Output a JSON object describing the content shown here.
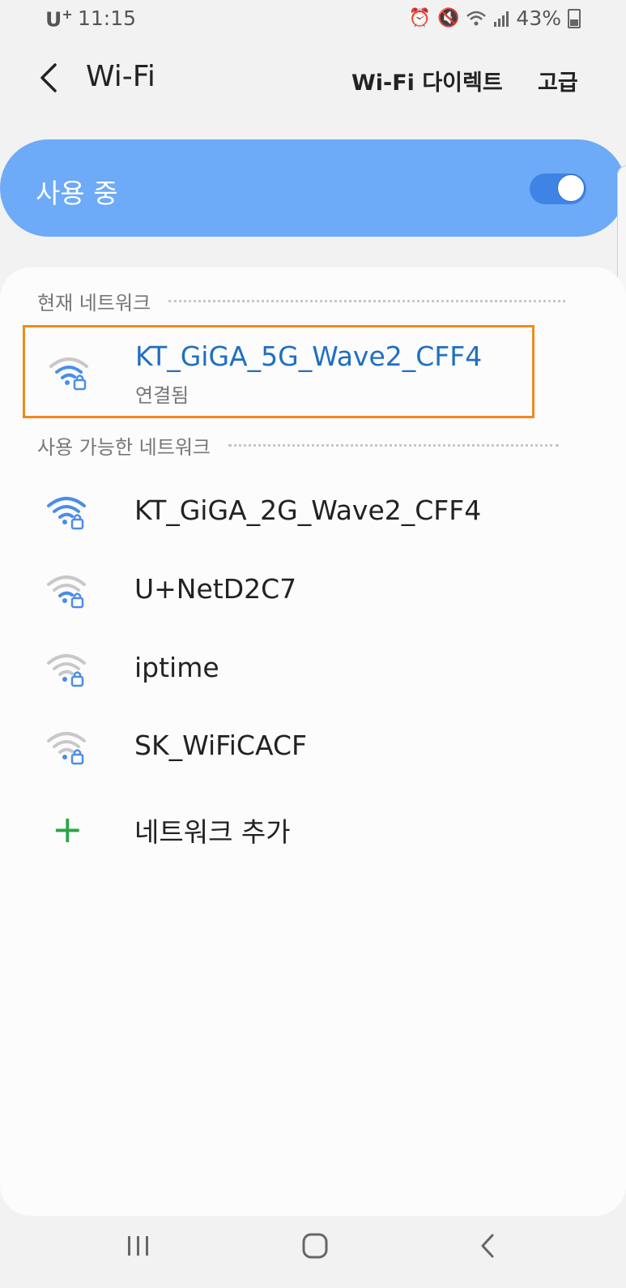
{
  "status_bar": {
    "carrier": "U",
    "carrier_sup": "+",
    "time": "11:15",
    "battery_percent": "43%",
    "icons": [
      "alarm-icon",
      "mute-icon",
      "wifi-status-icon",
      "signal-icon",
      "battery-icon"
    ]
  },
  "app_bar": {
    "title": "Wi-Fi",
    "wifi_direct_label": "Wi-Fi 다이렉트",
    "advanced_label": "고급"
  },
  "master_switch": {
    "label": "사용 중",
    "state": true,
    "accent_color": "#6daaf7"
  },
  "current_network": {
    "section_title": "현재 네트워크",
    "name": "KT_GiGA_5G_Wave2_CFF4",
    "status": "연결됨",
    "signal_level": 0.75,
    "highlight_color": "#f28a1b"
  },
  "available_networks": {
    "section_title": "사용 가능한 네트워크",
    "items": [
      {
        "name": "KT_GiGA_2G_Wave2_CFF4",
        "signal_level": 1.0,
        "secured": true
      },
      {
        "name": "U+NetD2C7",
        "signal_level": 0.5,
        "secured": true
      },
      {
        "name": "iptime",
        "signal_level": 0.25,
        "secured": true
      },
      {
        "name": "SK_WiFiCACF",
        "signal_level": 0.25,
        "secured": true
      }
    ],
    "add_network_label": "네트워크 추가"
  },
  "nav_bar": {
    "icons": [
      "recent-apps-icon",
      "home-icon",
      "back-icon"
    ]
  }
}
